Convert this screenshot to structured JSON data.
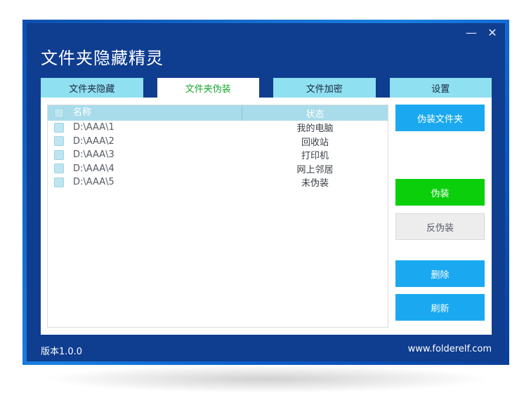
{
  "window": {
    "title": "文件夹隐藏精灵",
    "minimize_glyph": "—",
    "close_glyph": "✕"
  },
  "tabs": [
    {
      "label": "文件夹隐藏",
      "active": false
    },
    {
      "label": "文件夹伪装",
      "active": true
    },
    {
      "label": "文件加密",
      "active": false
    },
    {
      "label": "设置",
      "active": false
    }
  ],
  "list": {
    "headers": {
      "name": "名称",
      "status": "状态"
    },
    "rows": [
      {
        "name": "D:\\AAA\\1",
        "status": "我的电脑"
      },
      {
        "name": "D:\\AAA\\2",
        "status": "回收站"
      },
      {
        "name": "D:\\AAA\\3",
        "status": "打印机"
      },
      {
        "name": "D:\\AAA\\4",
        "status": "网上邻居"
      },
      {
        "name": "D:\\AAA\\5",
        "status": "未伪装"
      }
    ]
  },
  "buttons": {
    "disguise_folder": "伪装文件夹",
    "disguise": "伪装",
    "undisguise": "反伪装",
    "delete": "删除",
    "refresh": "刷新"
  },
  "footer": {
    "version": "版本1.0.0",
    "website": "www.folderelf.com"
  },
  "colors": {
    "window_bg": "#0f3d8f",
    "tab_bg": "#8fe0f0",
    "tab_active_text": "#1aa630",
    "button_blue": "#1aa9f0",
    "button_green": "#0ccf0c"
  }
}
